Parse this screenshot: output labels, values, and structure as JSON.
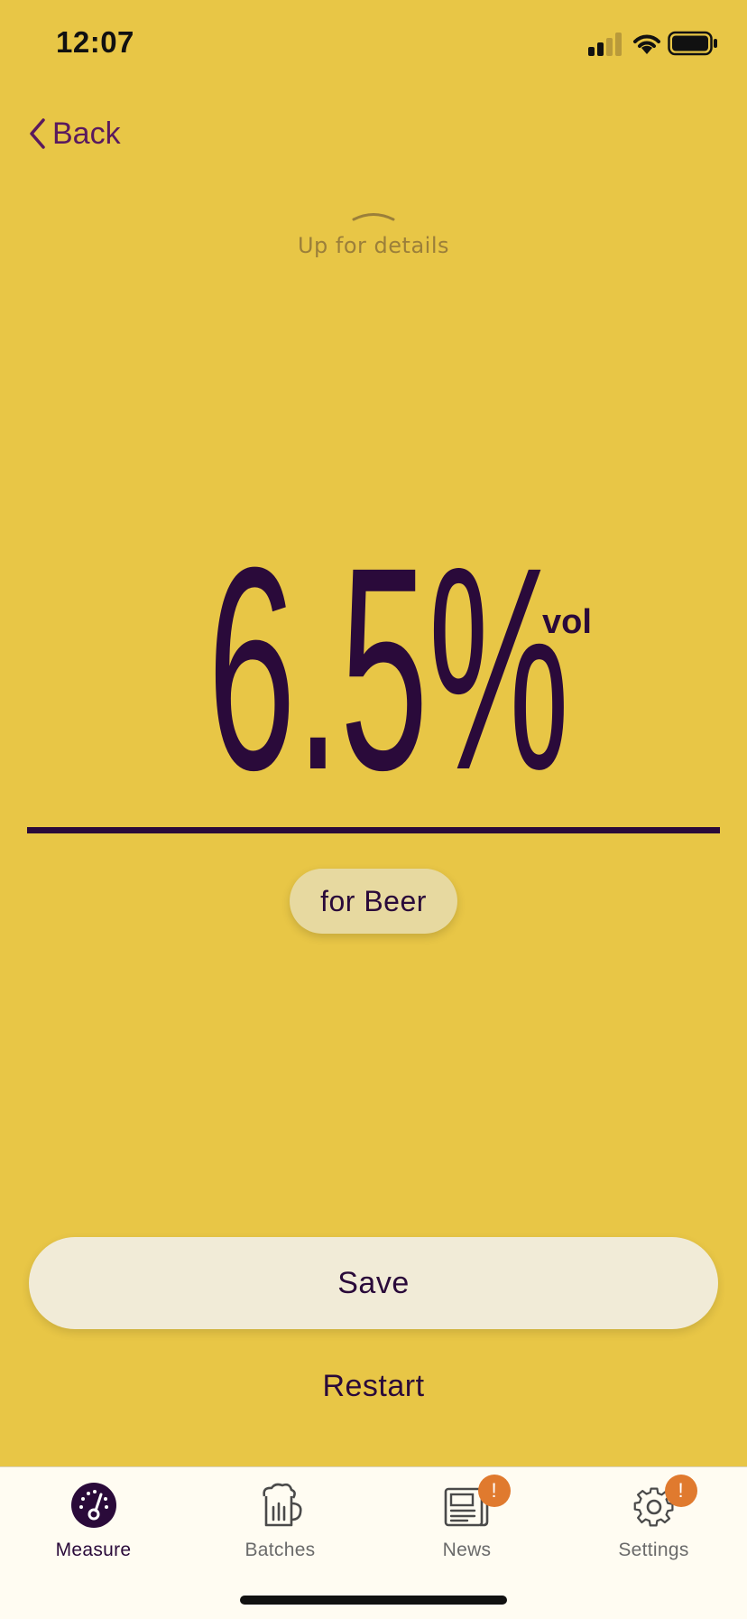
{
  "status_bar": {
    "time": "12:07",
    "icons": [
      "signal-icon",
      "wifi-icon",
      "battery-icon"
    ]
  },
  "nav": {
    "back_label": "Back"
  },
  "details_hint": {
    "label": "Up for details"
  },
  "reading": {
    "value": "6.5%",
    "unit": "vol"
  },
  "type_pill": {
    "label": "for Beer"
  },
  "actions": {
    "save_label": "Save",
    "restart_label": "Restart"
  },
  "tab_bar": {
    "tabs": [
      {
        "label": "Measure",
        "icon": "gauge-icon",
        "active": true,
        "badge": ""
      },
      {
        "label": "Batches",
        "icon": "beer-mug-icon",
        "active": false,
        "badge": ""
      },
      {
        "label": "News",
        "icon": "newspaper-icon",
        "active": false,
        "badge": "!"
      },
      {
        "label": "Settings",
        "icon": "gear-icon",
        "active": false,
        "badge": "!"
      }
    ]
  },
  "colors": {
    "background": "#E8C646",
    "text_primary": "#2A0A3A",
    "back_link": "#5A1A5E",
    "hint_text": "#9B7F3A",
    "pill_bg": "#E7D9A0",
    "button_bg": "#F1EBD7",
    "tab_bar_bg": "#FFFCF2",
    "badge": "#E07A2E"
  }
}
